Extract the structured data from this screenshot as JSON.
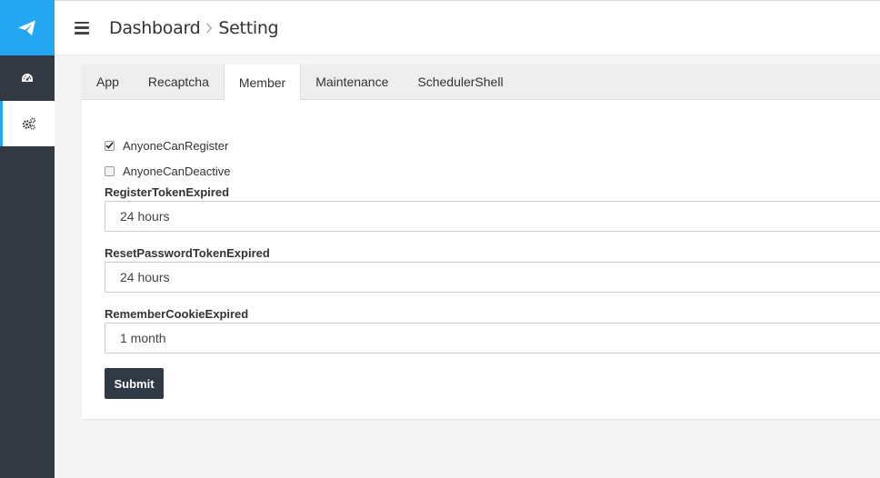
{
  "header": {
    "breadcrumb": [
      "Dashboard",
      "Setting"
    ]
  },
  "sidebar": {
    "items": [
      {
        "icon": "dashboard-icon"
      },
      {
        "icon": "gears-icon"
      }
    ]
  },
  "tabs": [
    {
      "label": "App"
    },
    {
      "label": "Recaptcha"
    },
    {
      "label": "Member"
    },
    {
      "label": "Maintenance"
    },
    {
      "label": "SchedulerShell"
    }
  ],
  "form": {
    "checkboxes": [
      {
        "label": "AnyoneCanRegister",
        "checked": true
      },
      {
        "label": "AnyoneCanDeactive",
        "checked": false
      }
    ],
    "fields": [
      {
        "label": "RegisterTokenExpired",
        "value": "24 hours"
      },
      {
        "label": "ResetPasswordTokenExpired",
        "value": "24 hours"
      },
      {
        "label": "RememberCookieExpired",
        "value": "1 month"
      }
    ],
    "submit_label": "Submit"
  },
  "colors": {
    "brand": "#22a7f0",
    "sidebar": "#343a43",
    "button": "#2f3a44"
  }
}
